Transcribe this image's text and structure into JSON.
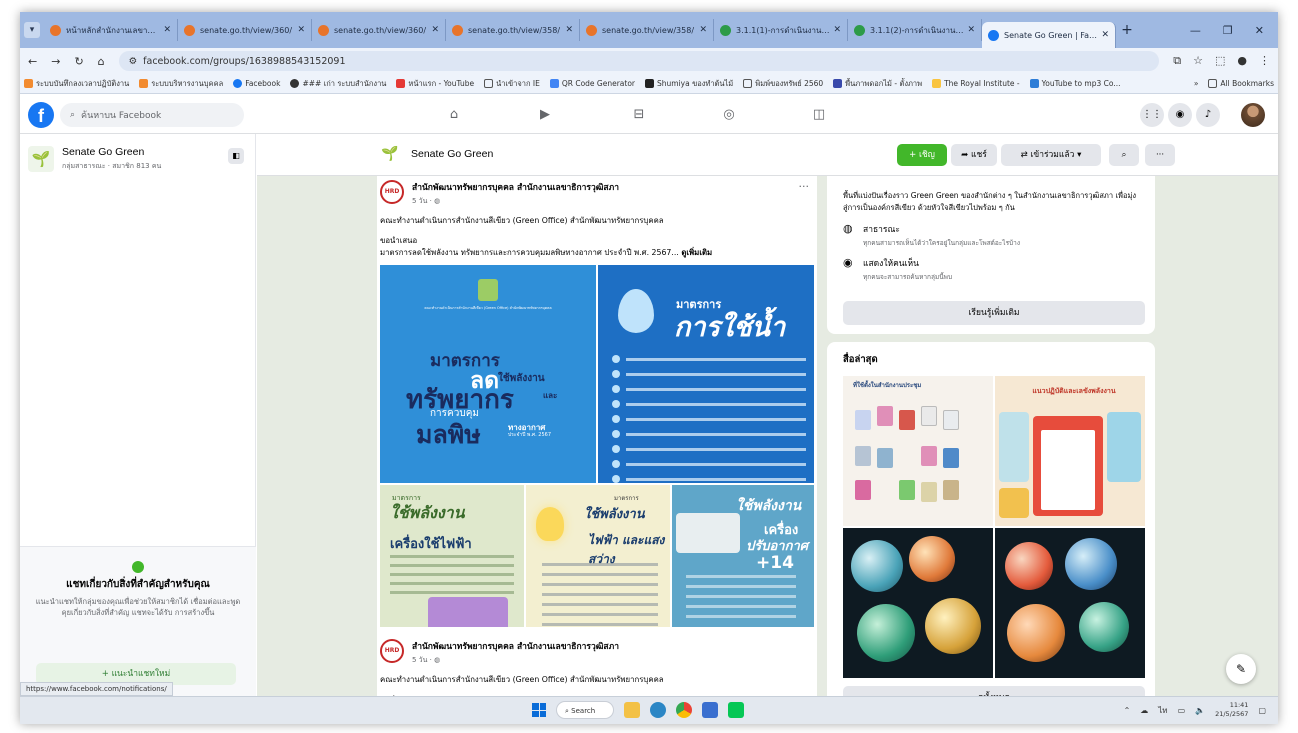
{
  "browser": {
    "tabs": [
      {
        "title": "หน้าหลักสำนักงานเลขาธิการ",
        "color": "#e8742a"
      },
      {
        "title": "senate.go.th/view/360/",
        "color": "#e8742a"
      },
      {
        "title": "senate.go.th/view/360/",
        "color": "#e8742a"
      },
      {
        "title": "senate.go.th/view/358/",
        "color": "#e8742a"
      },
      {
        "title": "senate.go.th/view/358/",
        "color": "#e8742a"
      },
      {
        "title": "3.1.1(1)-การดำเนินงานตามแผน",
        "color": "#2d9b48"
      },
      {
        "title": "3.1.1(2)-การดำเนินงานตามแผน",
        "color": "#2d9b48"
      },
      {
        "title": "Senate Go Green | Facebook",
        "color": "#1877f2"
      }
    ],
    "url": "facebook.com/groups/1638988543152091",
    "bookmarks": [
      "ระบบบันทึกลงเวลาปฏิบัติงาน",
      "ระบบบริหารงานบุคคล",
      "Facebook",
      "### เก่า ระบบสำนักงาน",
      "หน้าแรก - YouTube",
      "นำเข้าจาก IE",
      "QR Code Generator",
      "Shumiya ของทำต้นไม้",
      "พิมพ์ของทรัพย์ 2560",
      "พื้นภาพดอกไม้ - ตั้งภาพ",
      "The Royal Institute -",
      "YouTube to mp3 Co..."
    ],
    "all_bookmarks": "All Bookmarks"
  },
  "facebook": {
    "search_placeholder": "ค้นหาบน Facebook"
  },
  "sidebar": {
    "group_name": "Senate Go Green",
    "group_meta": "กลุ่มสาธารณะ · สมาชิก 813 คน",
    "promo_title": "แชทเกี่ยวกับสิ่งที่สำคัญสำหรับคุณ",
    "promo_text": "แนะนำแชทให้กลุ่มของคุณเพื่อช่วยให้สมาชิกได้ เชื่อมต่อและพูดคุยเกี่ยวกับสิ่งที่สำคัญ แชทจะได้รับ การสร้างขึ้น",
    "promo_button": "+ แนะนำแชทใหม่",
    "status_url": "https://www.facebook.com/notifications/"
  },
  "group_header": {
    "name": "Senate Go Green",
    "invite": "+ เชิญ",
    "share": "แชร์",
    "joined": "เข้าร่วมแล้ว"
  },
  "post": {
    "author": "สำนักพัฒนาทรัพยากรบุคคล สำนักงานเลขาธิการวุฒิสภา",
    "time": "5 วัน · ",
    "avatar_label": "HRD",
    "line1": "คณะทำงานดำเนินการสำนักงานสีเขียว (Green Office) สำนักพัฒนาทรัพยากรบุคคล",
    "line2": "ขอนำเสนอ",
    "line3": "มาตรการลดใช้พลังงาน ทรัพยากรและการควบคุมมลพิษทางอากาศ ประจำปี พ.ศ. 2567...",
    "see_more": "ดูเพิ่มเติม",
    "img_a_small": "คณะทำงานดำเนินการสำนักงานสีเขียว (Green Office) สำนักพัฒนาทรัพยากรบุคคล",
    "img_a_t1": "มาตรการ",
    "img_a_t2": "ลด",
    "img_a_t3": "ใช้พลังงาน",
    "img_a_t4": "ทรัพยากร",
    "img_a_t5": "และ",
    "img_a_t6": "การควบคุม",
    "img_a_t7": "มลพิษ",
    "img_a_t8": "ทางอากาศ",
    "img_a_t9": "ประจำปี พ.ศ. 2567",
    "img_b_t1": "มาตรการ",
    "img_b_t2": "การใช้น้ำ",
    "img_c_t1": "มาตรการ",
    "img_c_t2": "ใช้พลังงาน",
    "img_c_t3": "เครื่องใช้ไฟฟ้า",
    "img_d_t1": "มาตรการ",
    "img_d_t2": "ใช้พลังงาน",
    "img_d_t3": "ไฟฟ้า และแสงสว่าง",
    "img_e_t1": "ใช้พลังงาน",
    "img_e_t2": "เครื่อง",
    "img_e_t3": "ปรับอากาศ",
    "img_e_t4": "+14"
  },
  "right": {
    "desc": "พื้นที่แบ่งปันเรื่องราว Green Green ของสำนักต่าง ๆ ในสำนักงานเลขาธิการวุฒิสภา เพื่อมุ่งสู่การเป็นองค์กรสีเขียว ด้วยหัวใจสีเขียวไปพร้อม ๆ กัน",
    "public_title": "สาธารณะ",
    "public_sub": "ทุกคนสามารถเห็นได้ว่าใครอยู่ในกลุ่มและโพสต์อะไรบ้าง",
    "visible_title": "แสดงให้คนเห็น",
    "visible_sub": "ทุกคนจะสามารถค้นหากลุ่มนี้พบ",
    "learn_more": "เรียนรู้เพิ่มเติม",
    "media_title": "สื่อล่าสุด",
    "media_m1": "ที่ใช้ตั้งในสำนักงานประชุม",
    "media_m2": "แนวปฏิบัติและเลขังพลังงาน",
    "see_all": "ดูทั้งหมด"
  },
  "taskbar": {
    "search": "Search",
    "time": "11:41",
    "date": "21/5/2567"
  }
}
